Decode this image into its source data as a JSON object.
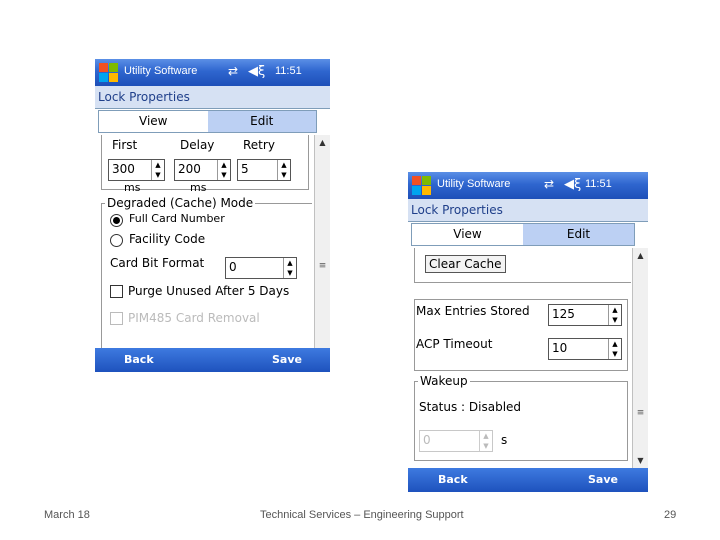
{
  "device_left": {
    "titlebar": {
      "app": "Utility Software",
      "time": "11:51"
    },
    "subheader": "Lock Properties",
    "tabs": [
      "View",
      "Edit"
    ],
    "columns": {
      "first": "First",
      "delay": "Delay",
      "retry": "Retry"
    },
    "values": {
      "first": "300",
      "delay": "200",
      "retry": "5"
    },
    "units": {
      "first": "ms",
      "delay": "ms"
    },
    "degraded_group": "Degraded (Cache) Mode",
    "radio_full": "Full Card Number",
    "radio_facility": "Facility Code",
    "card_bit_format_label": "Card Bit Format",
    "card_bit_format_value": "0",
    "purge_label": "Purge Unused After 5 Days",
    "pim_label": "PIM485 Card Removal",
    "softkeys": {
      "left": "Back",
      "right": "Save"
    }
  },
  "device_right": {
    "titlebar": {
      "app": "Utility Software",
      "time": "11:51"
    },
    "subheader": "Lock Properties",
    "tabs": [
      "View",
      "Edit"
    ],
    "clear_cache": "Clear Cache",
    "max_entries_label": "Max Entries Stored",
    "max_entries_value": "125",
    "acp_timeout_label": "ACP Timeout",
    "acp_timeout_value": "10",
    "wakeup_group": "Wakeup",
    "status_text": "Status : Disabled",
    "wakeup_value": "0",
    "wakeup_unit": "s",
    "softkeys": {
      "left": "Back",
      "right": "Save"
    }
  },
  "footer": {
    "date": "March 18",
    "center": "Technical Services – Engineering Support",
    "page": "29"
  }
}
